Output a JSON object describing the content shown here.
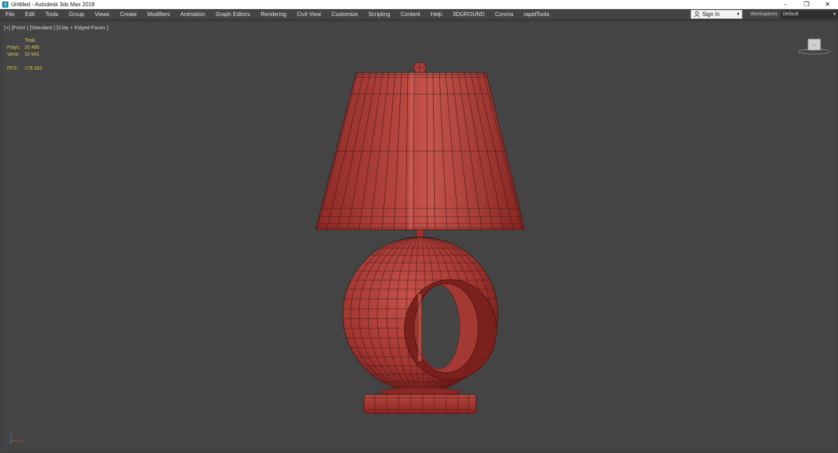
{
  "window": {
    "title": "Untitled - Autodesk 3ds Max 2018",
    "controls": [
      "–",
      "❐",
      "✕"
    ]
  },
  "menu": {
    "items": [
      "File",
      "Edit",
      "Tools",
      "Group",
      "Views",
      "Create",
      "Modifiers",
      "Animation",
      "Graph Editors",
      "Rendering",
      "Civil View",
      "Customize",
      "Scripting",
      "Content",
      "Help",
      "3DGROUND",
      "Corona",
      "rapidTools"
    ],
    "sign_in": "Sign In",
    "workspaces_label": "Workspaces:",
    "workspaces_value": "Default"
  },
  "viewport": {
    "labels": [
      "[+]",
      "[Front ]",
      "[Standard ]",
      "[Clay + Edged Faces ]"
    ],
    "stats": {
      "header": "Total",
      "polys_label": "Polys:",
      "polys_value": "20 490",
      "verts_label": "Verts:",
      "verts_value": "10 941",
      "fps_label": "FPS:",
      "fps_value": "178,282"
    }
  },
  "colors": {
    "viewport_bg": "#444444",
    "clay": "#b03a33",
    "stats_text": "#d9c84a"
  },
  "icons": {
    "app": "3dsmax-logo-icon",
    "sign_in": "person-icon",
    "viewcube": "viewcube-icon",
    "axis": "axis-tripod-icon"
  }
}
